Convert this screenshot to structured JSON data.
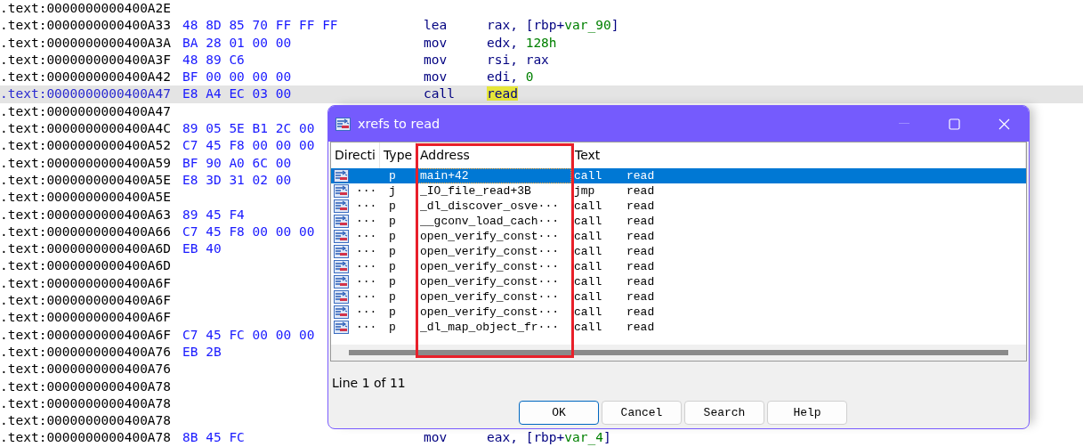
{
  "listing": {
    "lines": [
      {
        "address": ".text:0000000000400A2E",
        "selected": false
      },
      {
        "address": ".text:0000000000400A33",
        "bytes": "48 8D 85 70 FF FF FF",
        "mnemonic": "lea",
        "operands": [
          {
            "text": "rax, [rbp+",
            "kind": "plain"
          },
          {
            "text": "var_90",
            "kind": "var"
          },
          {
            "text": "]",
            "kind": "plain"
          }
        ],
        "selected": false
      },
      {
        "address": ".text:0000000000400A3A",
        "bytes": "BA 28 01 00 00",
        "mnemonic": "mov",
        "operands": [
          {
            "text": "edx, ",
            "kind": "plain"
          },
          {
            "text": "128h",
            "kind": "number"
          }
        ],
        "selected": false
      },
      {
        "address": ".text:0000000000400A3F",
        "bytes": "48 89 C6",
        "mnemonic": "mov",
        "operands": [
          {
            "text": "rsi, rax",
            "kind": "plain"
          }
        ],
        "selected": false
      },
      {
        "address": ".text:0000000000400A42",
        "bytes": "BF 00 00 00 00",
        "mnemonic": "mov",
        "operands": [
          {
            "text": "edi, ",
            "kind": "plain"
          },
          {
            "text": "0",
            "kind": "number"
          }
        ],
        "selected": false
      },
      {
        "address": ".text:0000000000400A47",
        "bytes": "E8 A4 EC 03 00",
        "mnemonic": "call",
        "operands": [
          {
            "text": "read",
            "kind": "highlight"
          }
        ],
        "selected": true
      },
      {
        "address": ".text:0000000000400A47",
        "selected": false
      },
      {
        "address": ".text:0000000000400A4C",
        "bytes": "89 05 5E B1 2C 00",
        "selected": false
      },
      {
        "address": ".text:0000000000400A52",
        "bytes": "C7 45 F8 00 00 00",
        "selected": false
      },
      {
        "address": ".text:0000000000400A59",
        "bytes": "BF 90 A0 6C 00",
        "selected": false
      },
      {
        "address": ".text:0000000000400A5E",
        "bytes": "E8 3D 31 02 00",
        "selected": false
      },
      {
        "address": ".text:0000000000400A5E",
        "selected": false
      },
      {
        "address": ".text:0000000000400A63",
        "bytes": "89 45 F4",
        "selected": false
      },
      {
        "address": ".text:0000000000400A66",
        "bytes": "C7 45 F8 00 00 00",
        "selected": false
      },
      {
        "address": ".text:0000000000400A6D",
        "bytes": "EB 40",
        "selected": false
      },
      {
        "address": ".text:0000000000400A6D",
        "selected": false
      },
      {
        "address": ".text:0000000000400A6F",
        "selected": false
      },
      {
        "address": ".text:0000000000400A6F",
        "selected": false
      },
      {
        "address": ".text:0000000000400A6F",
        "selected": false
      },
      {
        "address": ".text:0000000000400A6F",
        "bytes": "C7 45 FC 00 00 00",
        "selected": false
      },
      {
        "address": ".text:0000000000400A76",
        "bytes": "EB 2B",
        "selected": false
      },
      {
        "address": ".text:0000000000400A76",
        "selected": false
      },
      {
        "address": ".text:0000000000400A78",
        "selected": false
      },
      {
        "address": ".text:0000000000400A78",
        "selected": false
      },
      {
        "address": ".text:0000000000400A78",
        "selected": false
      },
      {
        "address": ".text:0000000000400A78",
        "bytes": "8B 45 FC",
        "mnemonic": "mov",
        "operands": [
          {
            "text": "eax, [rbp+",
            "kind": "plain"
          },
          {
            "text": "var_4",
            "kind": "var"
          },
          {
            "text": "]",
            "kind": "plain"
          }
        ],
        "selected": false
      }
    ]
  },
  "dialog": {
    "title": "xrefs to read",
    "columns": [
      "Directi",
      "Type",
      "Address",
      "Text"
    ],
    "rows": [
      {
        "type": "p",
        "address": "main+42",
        "instruction": "call",
        "target": "read",
        "selected": true
      },
      {
        "direction": "···",
        "type": "j",
        "address": "_IO_file_read+3B",
        "instruction": "jmp",
        "target": "read",
        "selected": false
      },
      {
        "direction": "···",
        "type": "p",
        "address": "_dl_discover_osve···",
        "instruction": "call",
        "target": "read",
        "selected": false
      },
      {
        "direction": "···",
        "type": "p",
        "address": "__gconv_load_cach···",
        "instruction": "call",
        "target": "read",
        "selected": false
      },
      {
        "direction": "···",
        "type": "p",
        "address": "open_verify_const···",
        "instruction": "call",
        "target": "read",
        "selected": false
      },
      {
        "direction": "···",
        "type": "p",
        "address": "open_verify_const···",
        "instruction": "call",
        "target": "read",
        "selected": false
      },
      {
        "direction": "···",
        "type": "p",
        "address": "open_verify_const···",
        "instruction": "call",
        "target": "read",
        "selected": false
      },
      {
        "direction": "···",
        "type": "p",
        "address": "open_verify_const···",
        "instruction": "call",
        "target": "read",
        "selected": false
      },
      {
        "direction": "···",
        "type": "p",
        "address": "open_verify_const···",
        "instruction": "call",
        "target": "read",
        "selected": false
      },
      {
        "direction": "···",
        "type": "p",
        "address": "open_verify_const···",
        "instruction": "call",
        "target": "read",
        "selected": false
      },
      {
        "direction": "···",
        "type": "p",
        "address": "_dl_map_object_fr···",
        "instruction": "call",
        "target": "read",
        "selected": false
      }
    ],
    "status": "Line 1 of 11",
    "buttons": [
      {
        "label": "OK",
        "default": true
      },
      {
        "label": "Cancel",
        "default": false
      },
      {
        "label": "Search",
        "default": false
      },
      {
        "label": "Help",
        "default": false
      }
    ]
  }
}
